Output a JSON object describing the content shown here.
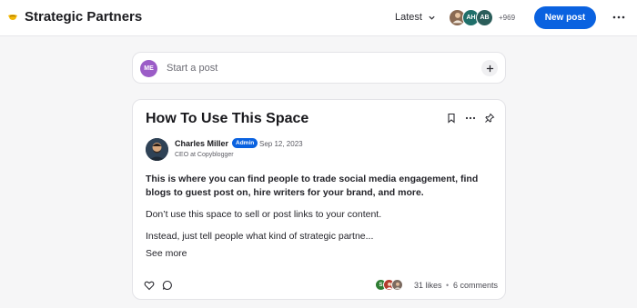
{
  "header": {
    "space_title": "Strategic Partners",
    "sort_label": "Latest",
    "members": [
      {
        "initials": "",
        "color": "#8a6a52"
      },
      {
        "initials": "AH",
        "color": "#1f6f6a"
      },
      {
        "initials": "AB",
        "color": "#2b5d5a"
      }
    ],
    "member_count": "+969",
    "new_post_label": "New post"
  },
  "composer": {
    "avatar_initials": "ME",
    "placeholder": "Start a post"
  },
  "post": {
    "title": "How To Use This Space",
    "author": {
      "name": "Charles Miller",
      "badge": "Admin",
      "date": "Sep 12, 2023",
      "headline": "CEO at Copyblogger"
    },
    "body_bold": "This is where you can find people to trade social media engagement, find blogs to guest post on, hire writers for your brand, and more.",
    "body_p2": "Don’t use this space to sell or post links to your content.",
    "body_p3": "Instead, just tell people what kind of strategic partne...",
    "see_more": "See more",
    "likers": [
      {
        "initials": "S",
        "color": "#2e7d32"
      },
      {
        "initials": "",
        "color": "#b43c2e"
      },
      {
        "initials": "",
        "color": "#7b6a60"
      }
    ],
    "likes": "31 likes",
    "separator": "•",
    "comments": "6 comments"
  },
  "colors": {
    "accent": "#0a62e0",
    "background": "#f6f6f7"
  }
}
